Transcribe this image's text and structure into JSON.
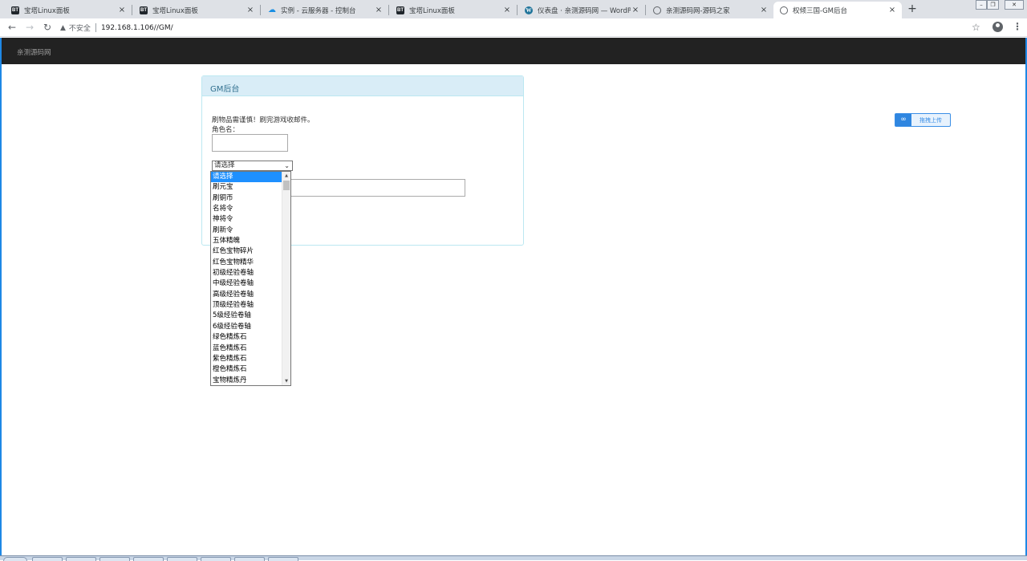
{
  "browser": {
    "tabs": [
      {
        "title": "宝塔Linux面板",
        "icon": "bt-icon"
      },
      {
        "title": "宝塔Linux面板",
        "icon": "bt-icon"
      },
      {
        "title": "实例 - 云服务器 - 控制台",
        "icon": "cloud-icon"
      },
      {
        "title": "宝塔Linux面板",
        "icon": "bt-icon"
      },
      {
        "title": "仪表盘 · 亲测源码网 — WordPress",
        "icon": "wordpress-icon"
      },
      {
        "title": "亲测源码网-源码之家",
        "icon": "globe-icon"
      },
      {
        "title": "权倾三国-GM后台",
        "icon": "globe-icon",
        "active": true
      }
    ],
    "bt_glyph": "BT",
    "close_glyph": "×",
    "newtab_glyph": "+",
    "security_label": "不安全",
    "url": "192.168.1.106//GM/"
  },
  "site": {
    "brand": "亲测源码网"
  },
  "panel": {
    "heading": "GM后台",
    "notice": "刷物品需谨慎！刷完游戏收邮件。",
    "role_label": "角色名："
  },
  "select": {
    "value": "请选择",
    "options": [
      "请选择",
      "刷元宝",
      "刷铜币",
      "名将令",
      "神将令",
      "刷新令",
      "五体精魄",
      "红色宝物碎片",
      "红色宝物精华",
      "初级经验卷轴",
      "中级经验卷轴",
      "高级经验卷轴",
      "顶级经验卷轴",
      "5级经验卷轴",
      "6级经验卷轴",
      "绿色精炼石",
      "蓝色精炼石",
      "紫色精炼石",
      "橙色精炼石",
      "宝物精炼丹"
    ],
    "selected_index": 0
  },
  "upload": {
    "label": "拖拽上传"
  },
  "colors": {
    "navbar": "#222222",
    "panel_heading_bg": "#d9edf7",
    "panel_heading_text": "#31708f",
    "selection": "#1e90ff"
  }
}
